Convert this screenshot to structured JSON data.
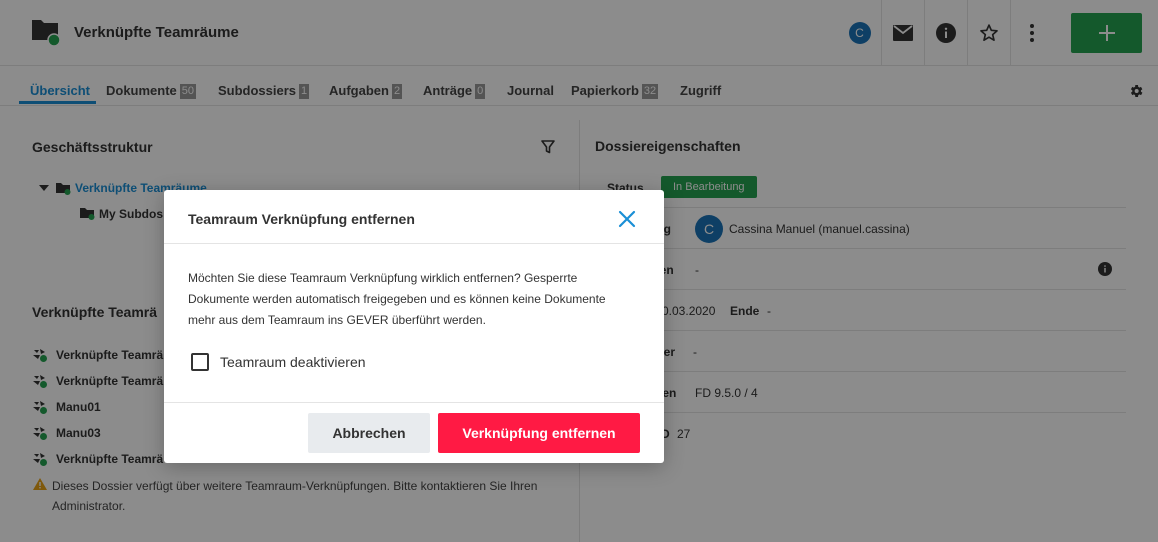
{
  "header": {
    "title": "Verknüpfte Teamräume",
    "avatar_letter": "C",
    "icons": [
      "dossier-icon",
      "mail-icon",
      "info-icon",
      "star-icon",
      "more-icon",
      "plus-icon"
    ]
  },
  "tabs": [
    {
      "label": "Übersicht",
      "badge": ""
    },
    {
      "label": "Dokumente",
      "badge": "50"
    },
    {
      "label": "Subdossiers",
      "badge": "1"
    },
    {
      "label": "Aufgaben",
      "badge": "2"
    },
    {
      "label": "Anträge",
      "badge": "0"
    },
    {
      "label": "Journal",
      "badge": ""
    },
    {
      "label": "Papierkorb",
      "badge": "32"
    },
    {
      "label": "Zugriff",
      "badge": ""
    }
  ],
  "left": {
    "structure_title": "Geschäftsstruktur",
    "tree": [
      "Verknüpfte Teamräume",
      "My Subdos"
    ],
    "linked_title": "Verknüpfte Teamrä",
    "linked_items": [
      "Verknüpfte Teamrä",
      "Verknüpfte Teamrä",
      "Manu01",
      "Manu03",
      "Verknüpfte Teamrä"
    ],
    "warning": "Dieses Dossier verfügt über weitere Teamraum-Verknüpfungen. Bitte kontaktieren Sie Ihren Administrator."
  },
  "right": {
    "title": "Dossiereigenschaften",
    "status_label": "Status",
    "status_value": "In Bearbeitung",
    "rows": [
      {
        "label": "tung",
        "value": "Cassina Manuel (manuel.cassina)",
        "avatar": "C"
      },
      {
        "label": "ngen",
        "value": "-"
      },
      {
        "label": "",
        "value": "0.03.2020",
        "label2": "Ende",
        "value2": "-"
      },
      {
        "label": "rter",
        "value": "-"
      },
      {
        "label": "hen",
        "value": "FD 9.5.0 / 4"
      },
      {
        "label": "D",
        "value": "27"
      }
    ]
  },
  "dialog": {
    "title": "Teamraum Verknüpfung entfernen",
    "message": "Möchten Sie diese Teamraum Verknüpfung wirklich entfernen? Gesperrte Dokumente werden automatisch freigegeben und es können keine Dokumente mehr aus dem Teamraum ins GEVER überführt werden.",
    "checkbox_label": "Teamraum deaktivieren",
    "checkbox_checked": false,
    "cancel_label": "Abbrechen",
    "confirm_label": "Verknüpfung entfernen"
  },
  "colors": {
    "accent": "#1a8fd6",
    "success": "#26a351",
    "danger": "#ff1a44"
  }
}
